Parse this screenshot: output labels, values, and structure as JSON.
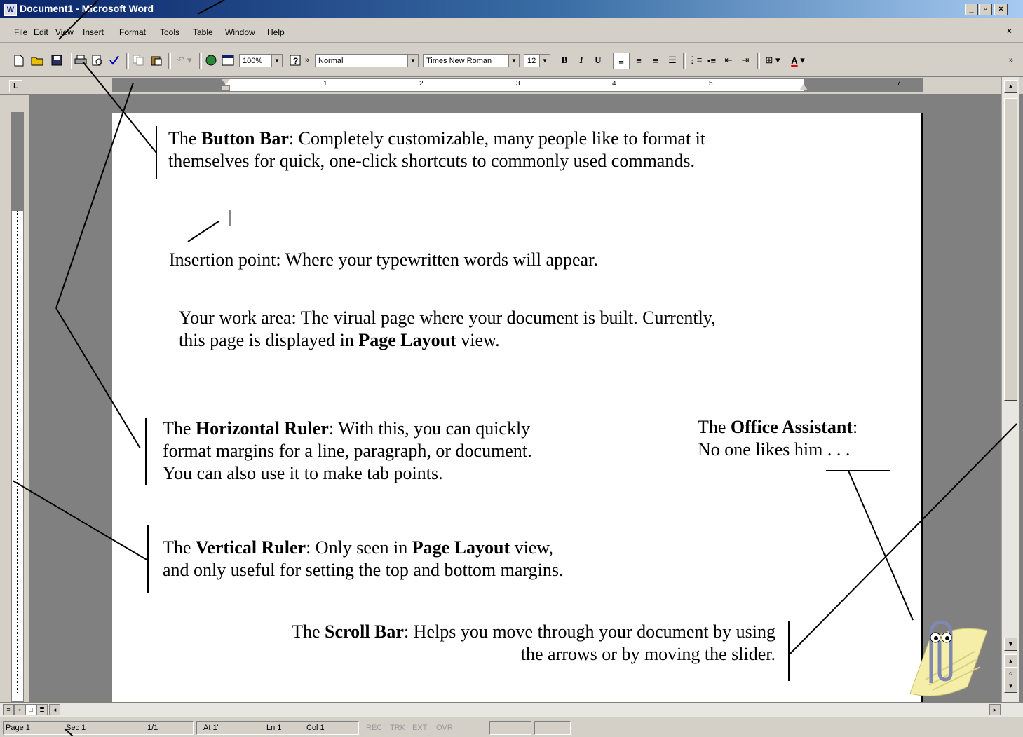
{
  "window": {
    "title": "Document1 - Microsoft Word",
    "controls": [
      "_",
      "▫",
      "×"
    ]
  },
  "menu": {
    "items": [
      "File",
      "Edit",
      "View",
      "Insert",
      "Format",
      "Tools",
      "Table",
      "Window",
      "Help"
    ],
    "close": "×"
  },
  "toolbar": {
    "zoom": "100%",
    "style": "Normal",
    "font": "Times New Roman",
    "size": "12",
    "bold": "B",
    "italic": "I",
    "underline": "U",
    "more": "»",
    "font_color_label": "A"
  },
  "ruler": {
    "numbers": [
      "1",
      "2",
      "3",
      "4",
      "5",
      "7"
    ],
    "tab_selector": "L"
  },
  "annotations": {
    "button_bar": {
      "title": "Button Bar",
      "line1_pre": "The ",
      "line1_post": ": Completely customizable, many people like to format it",
      "line2": "themselves for quick, one-click shortcuts to commonly used commands."
    },
    "insertion": "Insertion point: Where your typewritten words will appear.",
    "work_area": {
      "line1": "Your work area: The virual page where your document is built. Currently,",
      "line2_pre": "this page is displayed in ",
      "line2_bold": "Page Layout",
      "line2_post": " view."
    },
    "horizontal_ruler": {
      "pre": "The ",
      "bold": "Horizontal Ruler",
      "post": ": With this, you can quickly",
      "line2": "format margins for a line, paragraph, or document.",
      "line3": "You can also use it to make tab points."
    },
    "office_assistant": {
      "pre": "The ",
      "bold": "Office Assistant",
      "post": ":",
      "line2": "No one likes him . . ."
    },
    "vertical_ruler": {
      "pre": "The ",
      "bold": "Vertical Ruler",
      "mid": ": Only seen in ",
      "bold2": "Page Layout",
      "post": " view,",
      "line2": "and only useful for setting the top and bottom margins."
    },
    "scroll_bar": {
      "pre": "The ",
      "bold": "Scroll Bar",
      "post": ": Helps you move through your document by using",
      "line2": "the arrows or by moving the slider."
    }
  },
  "status": {
    "page": "Page 1",
    "sec": "Sec 1",
    "pages": "1/1",
    "at": "At 1\"",
    "ln": "Ln 1",
    "col": "Col 1",
    "rec": "REC",
    "trk": "TRK",
    "ext": "EXT",
    "ovr": "OVR"
  },
  "icons": [
    "new-doc-icon",
    "open-folder-icon",
    "save-icon",
    "print-icon",
    "print-preview-icon",
    "spelling-icon",
    "copy-icon",
    "paste-icon",
    "undo-icon",
    "web-icon",
    "table-icon",
    "help-icon",
    "align-left-icon",
    "align-center-icon",
    "align-right-icon",
    "justify-icon",
    "numbering-icon",
    "bullets-icon",
    "outdent-icon",
    "indent-icon",
    "borders-icon",
    "font-color-icon",
    "paperclip-assistant-icon"
  ]
}
